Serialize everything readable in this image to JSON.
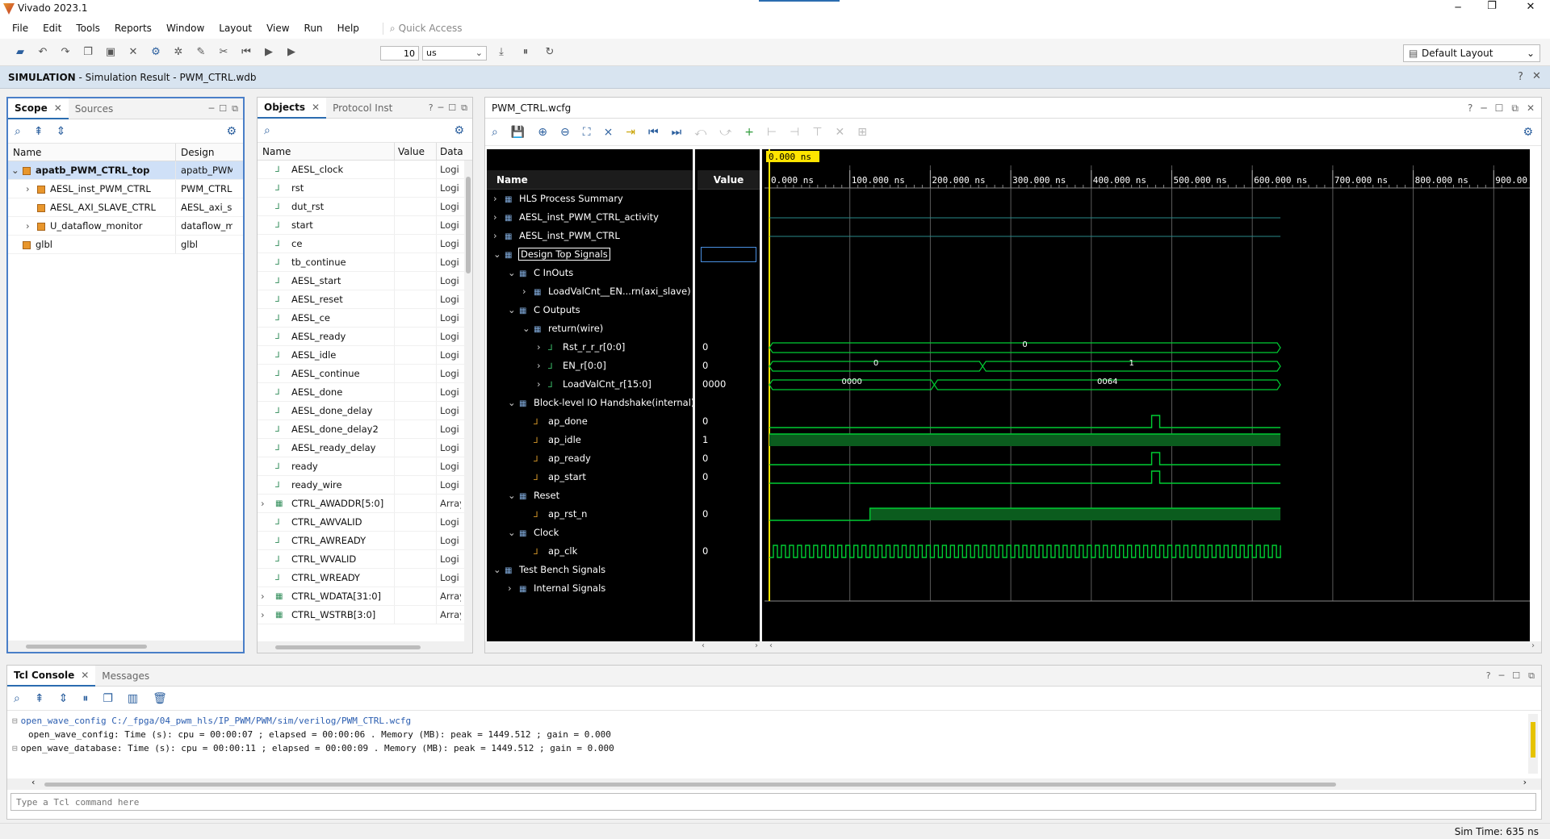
{
  "app": {
    "title": "Vivado 2023.1",
    "title_icon": "vivado-logo-icon"
  },
  "window_controls": {
    "minimize": "─",
    "restore": "❐",
    "close": "✕"
  },
  "menu": [
    "File",
    "Edit",
    "Tools",
    "Reports",
    "Window",
    "Layout",
    "View",
    "Run",
    "Help"
  ],
  "quick_access": {
    "placeholder": "Quick Access"
  },
  "toolbar": {
    "run_value": "10",
    "run_unit": "us",
    "layout": "Default Layout"
  },
  "simbar": {
    "mode": "SIMULATION",
    "subtitle": "- Simulation Result - PWM_CTRL.wdb"
  },
  "scope": {
    "tabs": [
      "Scope",
      "Sources"
    ],
    "columns": [
      "Name",
      "Design Unit"
    ],
    "rows": [
      {
        "name": "apatb_PWM_CTRL_top",
        "unit": "apatb_PWM",
        "level": 0,
        "expanded": true,
        "selected": true
      },
      {
        "name": "AESL_inst_PWM_CTRL",
        "unit": "PWM_CTRL",
        "level": 1,
        "expandable": true
      },
      {
        "name": "AESL_AXI_SLAVE_CTRL",
        "unit": "AESL_axi_s",
        "level": 1
      },
      {
        "name": "U_dataflow_monitor",
        "unit": "dataflow_m",
        "level": 1,
        "expandable": true
      },
      {
        "name": "glbl",
        "unit": "glbl",
        "level": 0
      }
    ]
  },
  "objects": {
    "tabs": [
      "Objects",
      "Protocol Inst"
    ],
    "columns": [
      "Name",
      "Value",
      "Data"
    ],
    "rows": [
      {
        "name": "AESL_clock",
        "type": "Logi"
      },
      {
        "name": "rst",
        "type": "Logi"
      },
      {
        "name": "dut_rst",
        "type": "Logi"
      },
      {
        "name": "start",
        "type": "Logi"
      },
      {
        "name": "ce",
        "type": "Logi"
      },
      {
        "name": "tb_continue",
        "type": "Logi"
      },
      {
        "name": "AESL_start",
        "type": "Logi"
      },
      {
        "name": "AESL_reset",
        "type": "Logi"
      },
      {
        "name": "AESL_ce",
        "type": "Logi"
      },
      {
        "name": "AESL_ready",
        "type": "Logi"
      },
      {
        "name": "AESL_idle",
        "type": "Logi"
      },
      {
        "name": "AESL_continue",
        "type": "Logi"
      },
      {
        "name": "AESL_done",
        "type": "Logi"
      },
      {
        "name": "AESL_done_delay",
        "type": "Logi"
      },
      {
        "name": "AESL_done_delay2",
        "type": "Logi"
      },
      {
        "name": "AESL_ready_delay",
        "type": "Logi"
      },
      {
        "name": "ready",
        "type": "Logi"
      },
      {
        "name": "ready_wire",
        "type": "Logi"
      },
      {
        "name": "CTRL_AWADDR[5:0]",
        "type": "Array",
        "expandable": true
      },
      {
        "name": "CTRL_AWVALID",
        "type": "Logi"
      },
      {
        "name": "CTRL_AWREADY",
        "type": "Logi"
      },
      {
        "name": "CTRL_WVALID",
        "type": "Logi"
      },
      {
        "name": "CTRL_WREADY",
        "type": "Logi"
      },
      {
        "name": "CTRL_WDATA[31:0]",
        "type": "Array",
        "expandable": true
      },
      {
        "name": "CTRL_WSTRB[3:0]",
        "type": "Array",
        "expandable": true
      }
    ]
  },
  "wave": {
    "tab": "PWM_CTRL.wcfg",
    "cursor_label": "0.000 ns",
    "columns": [
      "Name",
      "Value"
    ],
    "time_ticks": [
      "0.000 ns",
      "100.000 ns",
      "200.000 ns",
      "300.000 ns",
      "400.000 ns",
      "500.000 ns",
      "600.000 ns",
      "700.000 ns",
      "800.000 ns",
      "900.00"
    ],
    "rows": [
      {
        "name": "HLS Process Summary",
        "level": 0,
        "chev": "›",
        "value": ""
      },
      {
        "name": "AESL_inst_PWM_CTRL_activity",
        "level": 0,
        "chev": "›",
        "value": ""
      },
      {
        "name": "AESL_inst_PWM_CTRL",
        "level": 0,
        "chev": "›",
        "value": ""
      },
      {
        "name": "Design Top Signals",
        "level": 0,
        "chev": "⌄",
        "value": "",
        "selected": true
      },
      {
        "name": "C InOuts",
        "level": 1,
        "chev": "⌄",
        "value": ""
      },
      {
        "name": "LoadValCnt__EN...rn(axi_slave)",
        "level": 2,
        "chev": "›",
        "value": ""
      },
      {
        "name": "C Outputs",
        "level": 1,
        "chev": "⌄",
        "value": ""
      },
      {
        "name": "return(wire)",
        "level": 2,
        "chev": "⌄",
        "value": ""
      },
      {
        "name": "Rst_r_r_r[0:0]",
        "level": 3,
        "chev": "›",
        "value": "0"
      },
      {
        "name": "EN_r[0:0]",
        "level": 3,
        "chev": "›",
        "value": "0"
      },
      {
        "name": "LoadValCnt_r[15:0]",
        "level": 3,
        "chev": "›",
        "value": "0000"
      },
      {
        "name": "Block-level IO Handshake(internal)",
        "level": 1,
        "chev": "⌄",
        "value": ""
      },
      {
        "name": "ap_done",
        "level": 2,
        "chev": "",
        "value": "0"
      },
      {
        "name": "ap_idle",
        "level": 2,
        "chev": "",
        "value": "1"
      },
      {
        "name": "ap_ready",
        "level": 2,
        "chev": "",
        "value": "0"
      },
      {
        "name": "ap_start",
        "level": 2,
        "chev": "",
        "value": "0"
      },
      {
        "name": "Reset",
        "level": 1,
        "chev": "⌄",
        "value": ""
      },
      {
        "name": "ap_rst_n",
        "level": 2,
        "chev": "",
        "value": "0"
      },
      {
        "name": "Clock",
        "level": 1,
        "chev": "⌄",
        "value": ""
      },
      {
        "name": "ap_clk",
        "level": 2,
        "chev": "",
        "value": "0"
      },
      {
        "name": "Test Bench Signals",
        "level": 0,
        "chev": "⌄",
        "value": ""
      },
      {
        "name": "Internal Signals",
        "level": 1,
        "chev": "›",
        "value": ""
      }
    ],
    "bus_labels": {
      "rst": "0",
      "en_a": "0",
      "en_b": "1",
      "lvc_a": "0000",
      "lvc_b": "0064"
    }
  },
  "console": {
    "tabs": [
      "Tcl Console",
      "Messages"
    ],
    "lines": [
      "open_wave_config C:/_fpga/04_pwm_hls/IP_PWM/PWM/sim/verilog/PWM_CTRL.wcfg",
      "open_wave_config: Time (s): cpu = 00:00:07 ; elapsed = 00:00:06 . Memory (MB): peak = 1449.512 ; gain = 0.000",
      "open_wave_database: Time (s): cpu = 00:00:11 ; elapsed = 00:00:09 . Memory (MB): peak = 1449.512 ; gain = 0.000"
    ],
    "input_placeholder": "Type a Tcl command here"
  },
  "status": {
    "sim_time": "Sim Time: 635 ns"
  },
  "colors": {
    "wave_bg": "#000000",
    "signal": "#00cc33",
    "bus": "#00cc33",
    "cursor": "#ffe400",
    "grid": "#5a5a5a",
    "link": "#2a5db0"
  }
}
